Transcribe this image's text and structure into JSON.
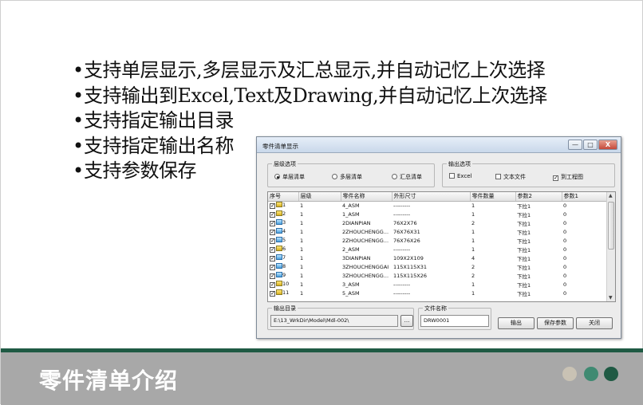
{
  "slide": {
    "bullet_char": "•",
    "bullets": [
      "支持单层显示,多层显示及汇总显示,并自动记忆上次选择",
      "支持输出到Excel,Text及Drawing,并自动记忆上次选择",
      "支持指定输出目录",
      "支持指定输出名称",
      "支持参数保存"
    ],
    "footer_title": "零件清单介绍",
    "colors": {
      "footer_bg": "#a8a8a8",
      "footer_line": "#1f5a44",
      "dot1": "#c9c2b4",
      "dot2": "#3f8a72",
      "dot3": "#1f5a44"
    }
  },
  "dialog": {
    "title": "零件清单显示",
    "title_buttons": {
      "minimize": "—",
      "maximize": "□",
      "close": "X"
    },
    "level_group": {
      "label": "层级选项",
      "options": [
        {
          "label": "单层清单",
          "checked": true
        },
        {
          "label": "多层清单",
          "checked": false
        },
        {
          "label": "汇总清单",
          "checked": false
        }
      ]
    },
    "output_group": {
      "label": "输出选项",
      "options": [
        {
          "label": "Excel",
          "checked": false,
          "mark": ""
        },
        {
          "label": "文本文件",
          "checked": false,
          "mark": ""
        },
        {
          "label": "到工程图",
          "checked": true,
          "mark": "✓"
        }
      ]
    },
    "table": {
      "columns": [
        "序号",
        "层级",
        "零件名称",
        "外形尺寸",
        "零件数量",
        "参数2",
        "参数1"
      ],
      "rows": [
        {
          "seq": "1",
          "icon": "folder",
          "level": "1",
          "name": "4_ASM",
          "size": "---------",
          "qty": "1",
          "p2": "下拉1",
          "p1": "0"
        },
        {
          "seq": "2",
          "icon": "folder",
          "level": "1",
          "name": "1_ASM",
          "size": "---------",
          "qty": "1",
          "p2": "下拉1",
          "p1": "0"
        },
        {
          "seq": "3",
          "icon": "part",
          "level": "1",
          "name": "2DIANPIAN",
          "size": "76X2X76",
          "qty": "2",
          "p2": "下拉1",
          "p1": "0"
        },
        {
          "seq": "4",
          "icon": "part",
          "level": "1",
          "name": "2ZHOUCHENGG...",
          "size": "76X76X31",
          "qty": "1",
          "p2": "下拉1",
          "p1": "0"
        },
        {
          "seq": "5",
          "icon": "part",
          "level": "1",
          "name": "2ZHOUCHENGG...",
          "size": "76X76X26",
          "qty": "1",
          "p2": "下拉1",
          "p1": "0"
        },
        {
          "seq": "6",
          "icon": "folder",
          "level": "1",
          "name": "2_ASM",
          "size": "---------",
          "qty": "1",
          "p2": "下拉1",
          "p1": "0"
        },
        {
          "seq": "7",
          "icon": "part",
          "level": "1",
          "name": "3DIANPIAN",
          "size": "109X2X109",
          "qty": "4",
          "p2": "下拉1",
          "p1": "0"
        },
        {
          "seq": "8",
          "icon": "part",
          "level": "1",
          "name": "3ZHOUCHENGGAI",
          "size": "115X115X31",
          "qty": "2",
          "p2": "下拉1",
          "p1": "0"
        },
        {
          "seq": "9",
          "icon": "part",
          "level": "1",
          "name": "3ZHOUCHENGG...",
          "size": "115X115X26",
          "qty": "2",
          "p2": "下拉1",
          "p1": "0"
        },
        {
          "seq": "10",
          "icon": "folder",
          "level": "1",
          "name": "3_ASM",
          "size": "---------",
          "qty": "1",
          "p2": "下拉1",
          "p1": "0"
        },
        {
          "seq": "11",
          "icon": "folder",
          "level": "1",
          "name": "5_ASM",
          "size": "---------",
          "qty": "1",
          "p2": "下拉1",
          "p1": "0"
        }
      ]
    },
    "output_dir": {
      "label": "输出目录",
      "value": "E:\\13_WrkDir\\Model\\Mdl-002\\",
      "browse": "..."
    },
    "file_name": {
      "label": "文件名称",
      "value": "DRW0001"
    },
    "buttons": {
      "output": "输出",
      "save": "保存参数",
      "close": "关闭"
    },
    "icons": {
      "minimize": "minimize-icon",
      "maximize": "maximize-icon",
      "close": "close-icon",
      "folder": "assembly-folder-icon",
      "part": "part-icon"
    }
  }
}
